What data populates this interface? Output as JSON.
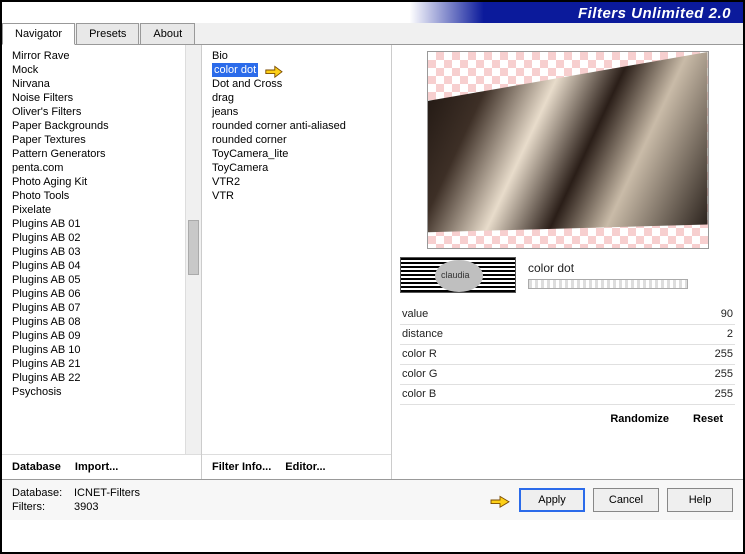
{
  "app": {
    "title": "Filters Unlimited 2.0"
  },
  "tabs": [
    {
      "label": "Navigator",
      "active": true
    },
    {
      "label": "Presets",
      "active": false
    },
    {
      "label": "About",
      "active": false
    }
  ],
  "categories": [
    "Mirror Rave",
    "Mock",
    "Nirvana",
    "Noise Filters",
    "Oliver's Filters",
    "Paper Backgrounds",
    "Paper Textures",
    "Pattern Generators",
    "penta.com",
    "Photo Aging Kit",
    "Photo Tools",
    "Pixelate",
    "Plugins AB 01",
    "Plugins AB 02",
    "Plugins AB 03",
    "Plugins AB 04",
    "Plugins AB 05",
    "Plugins AB 06",
    "Plugins AB 07",
    "Plugins AB 08",
    "Plugins AB 09",
    "Plugins AB 10",
    "Plugins AB 21",
    "Plugins AB 22",
    "Psychosis"
  ],
  "filters": [
    "Bio",
    "color dot",
    "Dot and Cross",
    "drag",
    "jeans",
    "rounded corner anti-aliased",
    "rounded corner",
    "ToyCamera_lite",
    "ToyCamera",
    "VTR2",
    "VTR"
  ],
  "selected_filter": "color dot",
  "preview": {
    "logo_text": "claudia",
    "filter_name": "color dot"
  },
  "params": [
    {
      "name": "value",
      "value": "90"
    },
    {
      "name": "distance",
      "value": "2"
    },
    {
      "name": "color R",
      "value": "255"
    },
    {
      "name": "color G",
      "value": "255"
    },
    {
      "name": "color B",
      "value": "255"
    }
  ],
  "cat_buttons": {
    "database": "Database",
    "import": "Import..."
  },
  "filter_buttons": {
    "info": "Filter Info...",
    "editor": "Editor..."
  },
  "preview_buttons": {
    "randomize": "Randomize",
    "reset": "Reset"
  },
  "footer": {
    "db_label": "Database:",
    "db_value": "ICNET-Filters",
    "filters_label": "Filters:",
    "filters_value": "3903",
    "apply": "Apply",
    "cancel": "Cancel",
    "help": "Help"
  }
}
